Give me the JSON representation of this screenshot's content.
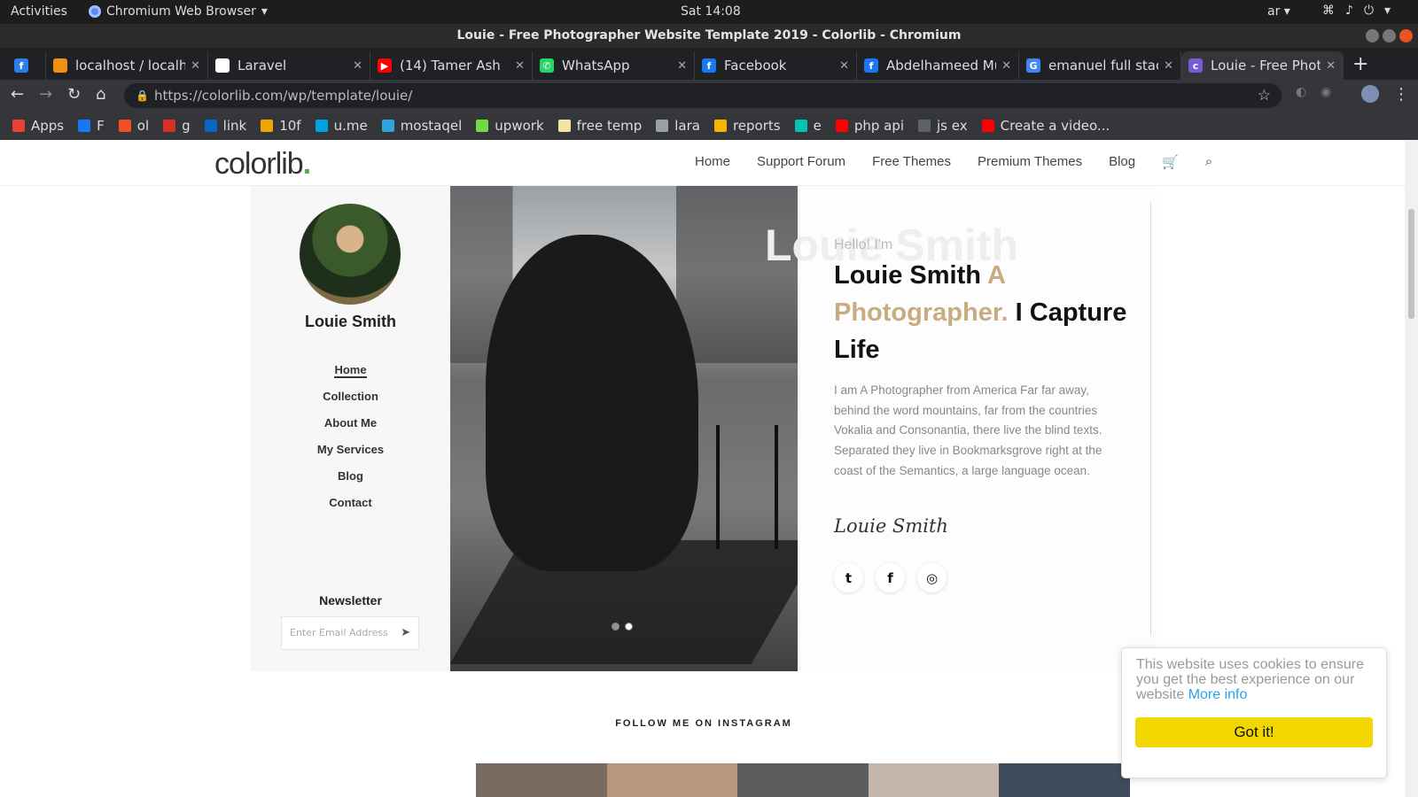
{
  "system": {
    "activities": "Activities",
    "app_name": "Chromium Web Browser",
    "clock": "Sat 14:08",
    "lang": "ar"
  },
  "window": {
    "title": "Louie - Free Photographer Website Template 2019 - Colorlib - Chromium"
  },
  "tabs": [
    {
      "title": "localhost / localh",
      "color": "#f29111"
    },
    {
      "title": "Laravel",
      "color": "#ffffff"
    },
    {
      "title": "(14) Tamer Ash",
      "color": "#ff0000"
    },
    {
      "title": "WhatsApp",
      "color": "#25d366"
    },
    {
      "title": "Facebook",
      "color": "#1877f2"
    },
    {
      "title": "Abdelhameed Mu",
      "color": "#1877f2"
    },
    {
      "title": "emanuel full stac",
      "color": "#4285f4"
    },
    {
      "title": "Louie - Free Phot",
      "color": "#7a5bd6"
    }
  ],
  "address": {
    "url": "https://colorlib.com/wp/template/louie/"
  },
  "bookmarks": [
    {
      "label": "Apps",
      "color": "#e94235"
    },
    {
      "label": "F",
      "color": "#1877f2"
    },
    {
      "label": "ol",
      "color": "#f25022"
    },
    {
      "label": "g",
      "color": "#d93025"
    },
    {
      "label": "link",
      "color": "#0a66c2"
    },
    {
      "label": "10f",
      "color": "#f0a500"
    },
    {
      "label": "u.me",
      "color": "#00a3e0"
    },
    {
      "label": "mostaqel",
      "color": "#2ca5e0"
    },
    {
      "label": "upwork",
      "color": "#6fda44"
    },
    {
      "label": "free temp",
      "color": "#f4e4a1"
    },
    {
      "label": "lara",
      "color": "#9aa0a6"
    },
    {
      "label": "reports",
      "color": "#f4b400"
    },
    {
      "label": "e",
      "color": "#00c4b4"
    },
    {
      "label": "php api",
      "color": "#ff0000"
    },
    {
      "label": "js ex",
      "color": "#5f6368"
    },
    {
      "label": "Create a video...",
      "color": "#ff0000"
    }
  ],
  "site": {
    "logo": "colorlib",
    "logo_dot": ".",
    "nav": [
      "Home",
      "Support Forum",
      "Free Themes",
      "Premium Themes",
      "Blog"
    ]
  },
  "profile": {
    "name": "Louie Smith",
    "nav": [
      "Home",
      "Collection",
      "About Me",
      "My Services",
      "Blog",
      "Contact"
    ],
    "newsletter_title": "Newsletter",
    "newsletter_placeholder": "Enter Email Address"
  },
  "hero": {
    "ghost": "Louie Smith",
    "hello": "Hello! I'm",
    "name": "Louie Smith",
    "accent": "A Photographer.",
    "rest": "I Capture Life",
    "bio": "I am A Photographer from America Far far away, behind the word mountains, far from the countries Vokalia and Consonantia, there live the blind texts. Separated they live in Bookmarksgrove right at the coast of the Semantics, a large language ocean.",
    "signature": "Louie Smith",
    "accent_color": "#c8ac80"
  },
  "instagram": {
    "title": "FOLLOW ME ON INSTAGRAM"
  },
  "cookie": {
    "message": "This website uses cookies to ensure you get the best experience on our website",
    "link": "More info",
    "button": "Got it!"
  }
}
